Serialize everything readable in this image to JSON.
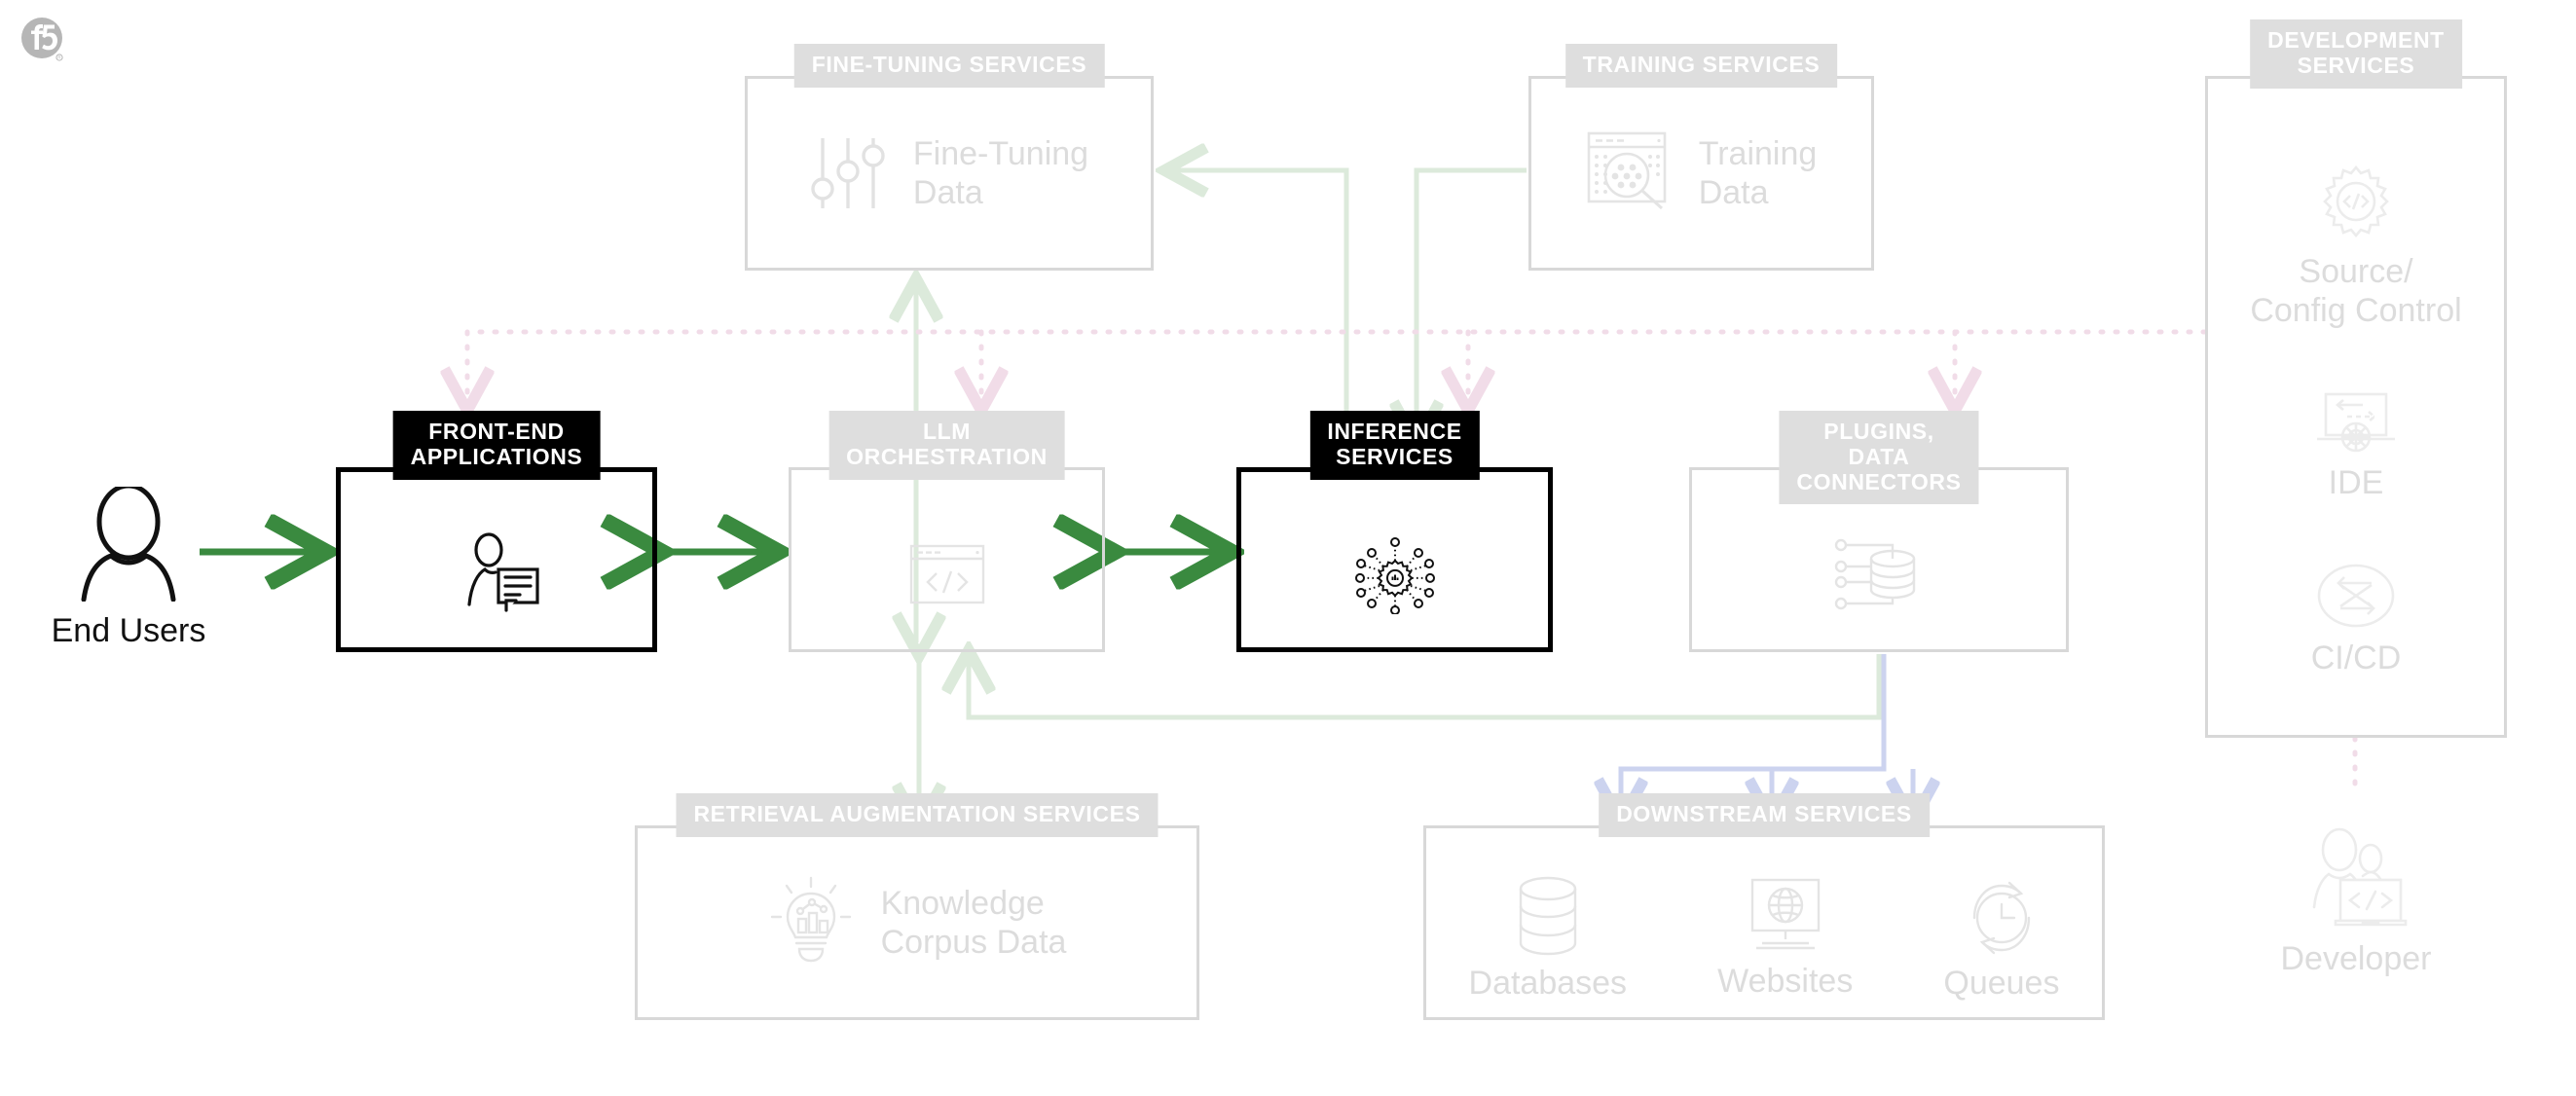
{
  "brand": {
    "logo_name": "f5-logo",
    "logo_mark": "f5"
  },
  "colors": {
    "arrow_green_strong": "#3a8a3f",
    "arrow_green_faint": "#dceadb",
    "arrow_pink_dotted": "#f3dfe9",
    "arrow_blue_faint": "#ccd3ef",
    "header_gray": "#dedede",
    "header_black": "#000000",
    "border_light": "#d8d8d8",
    "border_dark": "#000000",
    "label_gray": "#dcdcdc",
    "label_dark": "#111111"
  },
  "actors": {
    "end_users": {
      "label": "End Users",
      "icon": "person-icon"
    },
    "developer": {
      "label": "Developer",
      "icon": "developer-laptop-icon"
    }
  },
  "nodes": {
    "fine_tuning": {
      "header": "FINE-TUNING SERVICES",
      "item_label": "Fine-Tuning\nData",
      "icon": "sliders-icon",
      "style": "light"
    },
    "training": {
      "header": "TRAINING SERVICES",
      "item_label": "Training\nData",
      "icon": "data-search-window-icon",
      "style": "light"
    },
    "development": {
      "header": "DEVELOPMENT\nSERVICES",
      "style": "light",
      "items": [
        {
          "label": "Source/\nConfig Control",
          "icon": "gear-code-icon"
        },
        {
          "label": "IDE",
          "icon": "laptop-gear-icon"
        },
        {
          "label": "CI/CD",
          "icon": "infinity-cycle-icon"
        }
      ]
    },
    "frontend": {
      "header": "FRONT-END\nAPPLICATIONS",
      "icon": "person-chat-icon",
      "style": "dark"
    },
    "llm_orchestration": {
      "header": "LLM\nORCHESTRATION",
      "icon": "code-window-icon",
      "style": "light"
    },
    "inference": {
      "header": "INFERENCE\nSERVICES",
      "icon": "gear-nodes-icon",
      "style": "dark"
    },
    "plugins": {
      "header": "PLUGINS,\nDATA CONNECTORS",
      "icon": "database-connector-icon",
      "style": "light"
    },
    "retrieval": {
      "header": "RETRIEVAL AUGMENTATION SERVICES",
      "item_label": "Knowledge\nCorpus Data",
      "icon": "lightbulb-chart-icon",
      "style": "light"
    },
    "downstream": {
      "header": "DOWNSTREAM SERVICES",
      "style": "light",
      "items": [
        {
          "label": "Databases",
          "icon": "database-cylinder-icon"
        },
        {
          "label": "Websites",
          "icon": "monitor-globe-icon"
        },
        {
          "label": "Queues",
          "icon": "clock-cycle-icon"
        }
      ]
    }
  }
}
